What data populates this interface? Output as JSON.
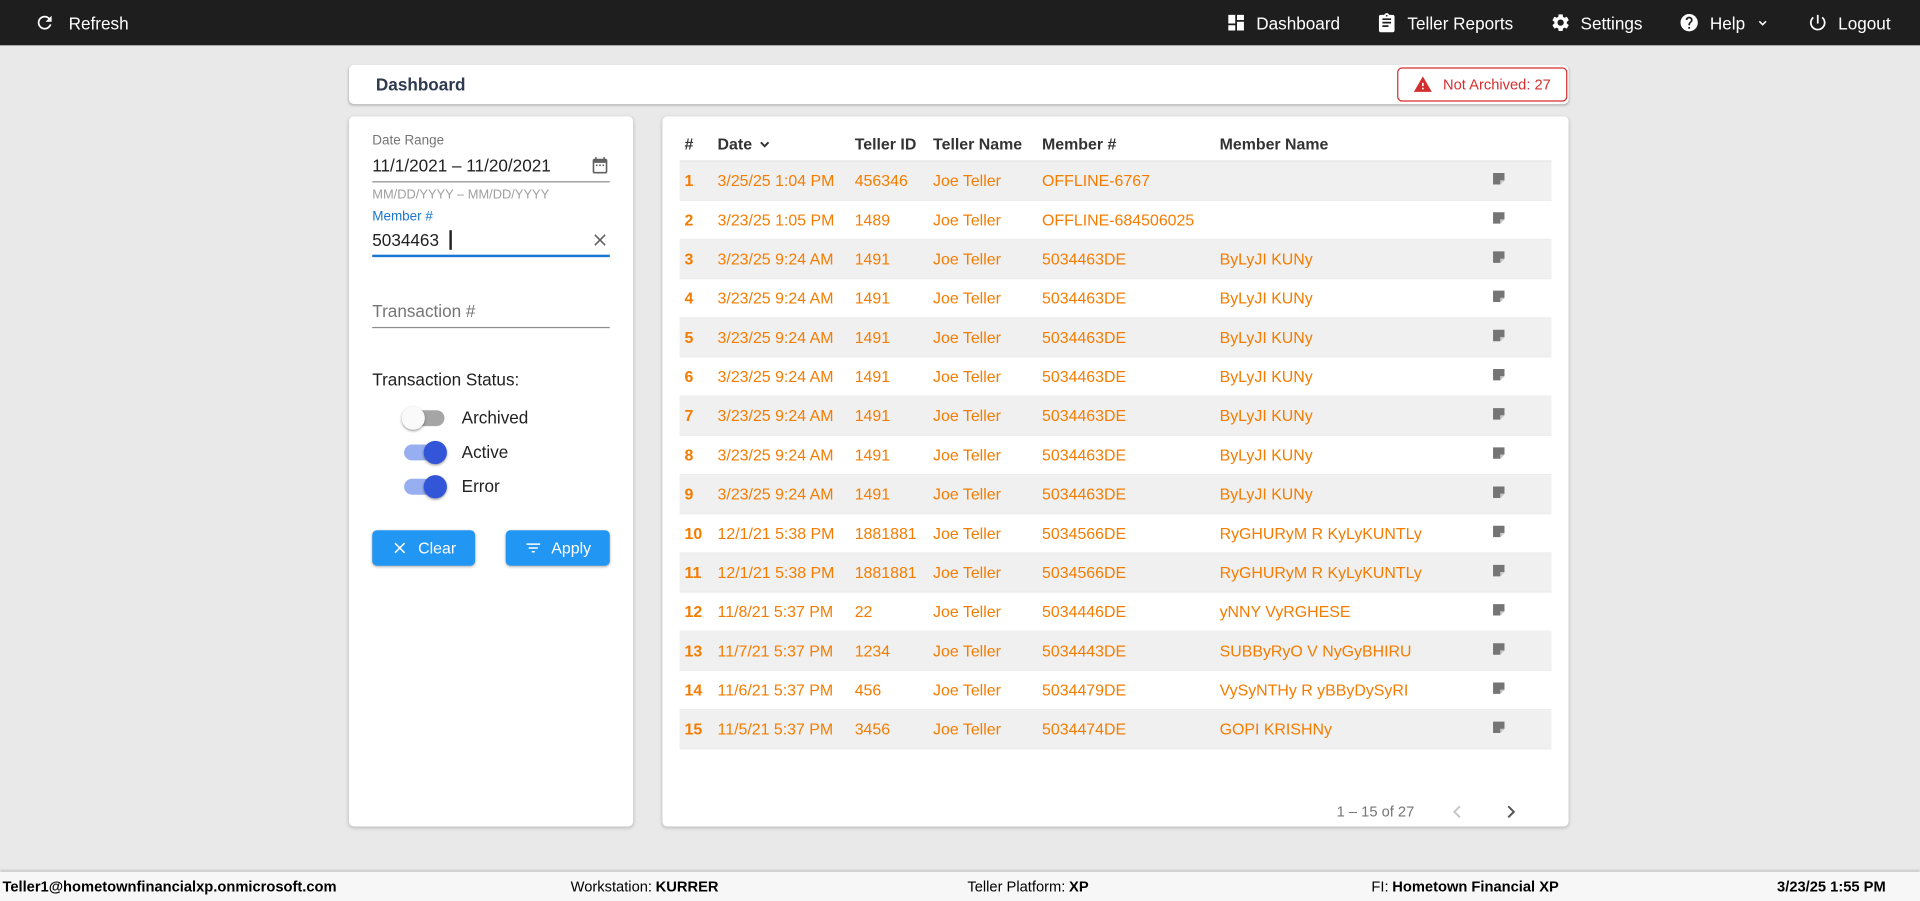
{
  "topbar": {
    "refresh_label": "Refresh",
    "items": [
      {
        "id": "dashboard",
        "label": "Dashboard",
        "icon": "dashboard-icon"
      },
      {
        "id": "teller-reports",
        "label": "Teller Reports",
        "icon": "reports-icon"
      },
      {
        "id": "settings",
        "label": "Settings",
        "icon": "gear-icon"
      },
      {
        "id": "help",
        "label": "Help",
        "icon": "help-icon",
        "chevron": true
      },
      {
        "id": "logout",
        "label": "Logout",
        "icon": "power-icon"
      }
    ]
  },
  "header": {
    "title": "Dashboard",
    "not_archived_badge": "Not Archived: 27"
  },
  "filters": {
    "date_range": {
      "label": "Date Range",
      "value": "11/1/2021 – 11/20/2021",
      "helper": "MM/DD/YYYY – MM/DD/YYYY"
    },
    "member": {
      "label": "Member #",
      "value": "5034463"
    },
    "transaction": {
      "placeholder": "Transaction #"
    },
    "status_label": "Transaction Status:",
    "toggles": [
      {
        "label": "Archived",
        "on": false
      },
      {
        "label": "Active",
        "on": true
      },
      {
        "label": "Error",
        "on": true
      }
    ],
    "clear_label": "Clear",
    "apply_label": "Apply"
  },
  "table": {
    "columns": [
      "#",
      "Date",
      "Teller ID",
      "Teller Name",
      "Member #",
      "Member Name",
      ""
    ],
    "sort_column": "Date",
    "rows": [
      {
        "num": "1",
        "date": "3/25/25 1:04 PM",
        "teller_id": "456346",
        "teller_name": "Joe Teller",
        "member_num": "OFFLINE-6767",
        "member_name": ""
      },
      {
        "num": "2",
        "date": "3/23/25 1:05 PM",
        "teller_id": "1489",
        "teller_name": "Joe Teller",
        "member_num": "OFFLINE-684506025",
        "member_name": ""
      },
      {
        "num": "3",
        "date": "3/23/25 9:24 AM",
        "teller_id": "1491",
        "teller_name": "Joe Teller",
        "member_num": "5034463DE",
        "member_name": "ByLyJI KUNy"
      },
      {
        "num": "4",
        "date": "3/23/25 9:24 AM",
        "teller_id": "1491",
        "teller_name": "Joe Teller",
        "member_num": "5034463DE",
        "member_name": "ByLyJI KUNy"
      },
      {
        "num": "5",
        "date": "3/23/25 9:24 AM",
        "teller_id": "1491",
        "teller_name": "Joe Teller",
        "member_num": "5034463DE",
        "member_name": "ByLyJI KUNy"
      },
      {
        "num": "6",
        "date": "3/23/25 9:24 AM",
        "teller_id": "1491",
        "teller_name": "Joe Teller",
        "member_num": "5034463DE",
        "member_name": "ByLyJI KUNy"
      },
      {
        "num": "7",
        "date": "3/23/25 9:24 AM",
        "teller_id": "1491",
        "teller_name": "Joe Teller",
        "member_num": "5034463DE",
        "member_name": "ByLyJI KUNy"
      },
      {
        "num": "8",
        "date": "3/23/25 9:24 AM",
        "teller_id": "1491",
        "teller_name": "Joe Teller",
        "member_num": "5034463DE",
        "member_name": "ByLyJI KUNy"
      },
      {
        "num": "9",
        "date": "3/23/25 9:24 AM",
        "teller_id": "1491",
        "teller_name": "Joe Teller",
        "member_num": "5034463DE",
        "member_name": "ByLyJI KUNy"
      },
      {
        "num": "10",
        "date": "12/1/21 5:38 PM",
        "teller_id": "1881881",
        "teller_name": "Joe Teller",
        "member_num": "5034566DE",
        "member_name": "RyGHURyM R KyLyKUNTLy"
      },
      {
        "num": "11",
        "date": "12/1/21 5:38 PM",
        "teller_id": "1881881",
        "teller_name": "Joe Teller",
        "member_num": "5034566DE",
        "member_name": "RyGHURyM R KyLyKUNTLy"
      },
      {
        "num": "12",
        "date": "11/8/21 5:37 PM",
        "teller_id": "22",
        "teller_name": "Joe Teller",
        "member_num": "5034446DE",
        "member_name": "yNNY VyRGHESE"
      },
      {
        "num": "13",
        "date": "11/7/21 5:37 PM",
        "teller_id": "1234",
        "teller_name": "Joe Teller",
        "member_num": "5034443DE",
        "member_name": "SUBByRyO V NyGyBHIRU"
      },
      {
        "num": "14",
        "date": "11/6/21 5:37 PM",
        "teller_id": "456",
        "teller_name": "Joe Teller",
        "member_num": "5034479DE",
        "member_name": "VySyNTHy R yBByDySyRI"
      },
      {
        "num": "15",
        "date": "11/5/21 5:37 PM",
        "teller_id": "3456",
        "teller_name": "Joe Teller",
        "member_num": "5034474DE",
        "member_name": "GOPI KRISHNy"
      }
    ],
    "pagination": {
      "range": "1 – 15 of 27"
    }
  },
  "footer": {
    "user": "Teller1@hometownfinancialxp.onmicrosoft.com",
    "workstation_label": "Workstation:",
    "workstation": "KURRER",
    "platform_label": "Teller Platform:",
    "platform": "XP",
    "fi_label": "FI:",
    "fi": "Hometown Financial XP",
    "datetime": "3/23/25 1:55 PM"
  },
  "colors": {
    "accent_blue": "#2196f3",
    "focus_blue": "#1976d2",
    "orange": "#f57c00",
    "alert_red": "#d32f2f",
    "toggle_on": "#3355d8",
    "toggle_track_on": "#97aef0"
  }
}
